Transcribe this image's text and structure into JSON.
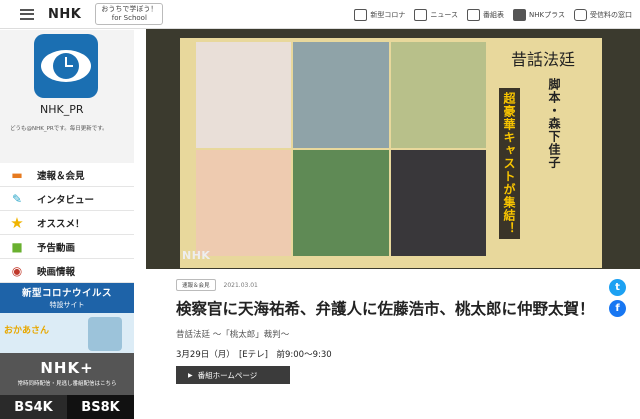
{
  "header": {
    "logo": "NHK",
    "school_line1": "おうちで学ぼう！",
    "school_line2": "for School",
    "nav": [
      {
        "label": "新型コロナ",
        "icon": "virus-icon"
      },
      {
        "label": "ニュース",
        "icon": "news-icon"
      },
      {
        "label": "番組表",
        "icon": "schedule-grid-icon"
      },
      {
        "label": "NHKプラス",
        "icon": "nhk-plus-icon"
      },
      {
        "label": "受信料の窓口",
        "icon": "receipt-window-icon"
      }
    ]
  },
  "sidebar": {
    "profile_name": "NHK_PR",
    "profile_desc": "どうも@NHK_PRです。毎日更新です。",
    "menu": [
      {
        "label": "速報＆会見",
        "icon": "press-icon"
      },
      {
        "label": "インタビュー",
        "icon": "pen-icon"
      },
      {
        "label": "オススメ！",
        "icon": "star-icon"
      },
      {
        "label": "予告動画",
        "icon": "clapperboard-icon"
      },
      {
        "label": "映画情報",
        "icon": "film-reel-icon"
      }
    ],
    "corona_title": "新型コロナウイルス",
    "corona_sub": "特設サイト",
    "kids_title": "おかあさん",
    "plus_title": "NHK+",
    "plus_sub": "常時同時配信・見逃し番組配信はこちら",
    "bs4k": "BS4K",
    "bs8k": "BS8K"
  },
  "hero": {
    "logo": "昔話法廷",
    "credit": "脚本・森下佳子",
    "catch": "超豪華キャストが集結！",
    "brand": "NHK"
  },
  "article": {
    "badge": "速報＆会見",
    "date": "2021.03.01",
    "headline": "検察官に天海祐希、弁護人に佐藤浩市、桃太郎に仲野太賀！",
    "program": "昔話法廷 〜「桃太郎」裁判〜",
    "airtime": "3月29日（月）　[Eテレ]　前9:00〜9:30",
    "home_button": "番組ホームページ"
  }
}
